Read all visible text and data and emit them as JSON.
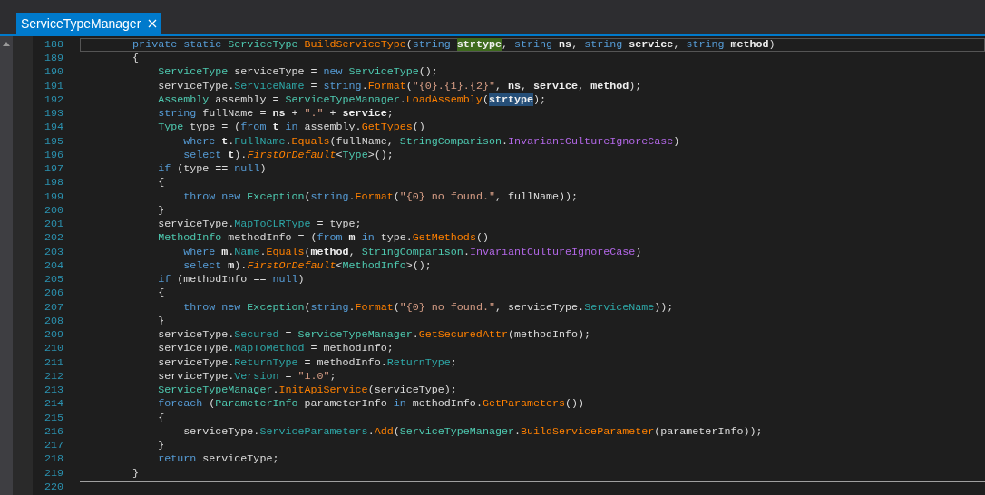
{
  "tabs": [
    {
      "label": "ServiceTypeManager",
      "selected": true
    }
  ],
  "lines": [
    {
      "num": "188",
      "current": true,
      "method_end": false,
      "tokens": [
        {
          "text": "        private static ",
          "kind": "keyword"
        },
        {
          "text": "ServiceType ",
          "kind": "type"
        },
        {
          "text": "BuildServiceType",
          "kind": "method"
        },
        {
          "text": "(",
          "kind": "plain"
        },
        {
          "text": "string ",
          "kind": "keyword"
        },
        {
          "text": "strtype",
          "kind": "highlight-def"
        },
        {
          "text": ", ",
          "kind": "plain"
        },
        {
          "text": "string ",
          "kind": "keyword"
        },
        {
          "text": "ns",
          "kind": "param"
        },
        {
          "text": ", ",
          "kind": "plain"
        },
        {
          "text": "string ",
          "kind": "keyword"
        },
        {
          "text": "service",
          "kind": "param"
        },
        {
          "text": ", ",
          "kind": "plain"
        },
        {
          "text": "string ",
          "kind": "keyword"
        },
        {
          "text": "method",
          "kind": "param"
        },
        {
          "text": ")",
          "kind": "plain"
        }
      ]
    },
    {
      "num": "189",
      "current": false,
      "method_end": false,
      "tokens": [
        {
          "text": "        {",
          "kind": "plain"
        }
      ]
    },
    {
      "num": "190",
      "current": false,
      "method_end": false,
      "tokens": [
        {
          "text": "            ServiceType",
          "kind": "type"
        },
        {
          "text": " serviceType = ",
          "kind": "plain"
        },
        {
          "text": "new ",
          "kind": "keyword"
        },
        {
          "text": "ServiceType",
          "kind": "type"
        },
        {
          "text": "();",
          "kind": "plain"
        }
      ]
    },
    {
      "num": "191",
      "current": false,
      "method_end": false,
      "tokens": [
        {
          "text": "            serviceType.",
          "kind": "plain"
        },
        {
          "text": "ServiceName",
          "kind": "property"
        },
        {
          "text": " = ",
          "kind": "plain"
        },
        {
          "text": "string",
          "kind": "keyword"
        },
        {
          "text": ".",
          "kind": "plain"
        },
        {
          "text": "Format",
          "kind": "method"
        },
        {
          "text": "(",
          "kind": "plain"
        },
        {
          "text": "\"{0}.{1}.{2}\"",
          "kind": "string"
        },
        {
          "text": ", ",
          "kind": "plain"
        },
        {
          "text": "ns",
          "kind": "param"
        },
        {
          "text": ", ",
          "kind": "plain"
        },
        {
          "text": "service",
          "kind": "param"
        },
        {
          "text": ", ",
          "kind": "plain"
        },
        {
          "text": "method",
          "kind": "param"
        },
        {
          "text": ");",
          "kind": "plain"
        }
      ]
    },
    {
      "num": "192",
      "current": false,
      "method_end": false,
      "tokens": [
        {
          "text": "            Assembly",
          "kind": "type"
        },
        {
          "text": " assembly = ",
          "kind": "plain"
        },
        {
          "text": "ServiceTypeManager",
          "kind": "type"
        },
        {
          "text": ".",
          "kind": "plain"
        },
        {
          "text": "LoadAssembly",
          "kind": "method"
        },
        {
          "text": "(",
          "kind": "plain"
        },
        {
          "text": "strtype",
          "kind": "highlight-ref"
        },
        {
          "text": ");",
          "kind": "plain"
        }
      ]
    },
    {
      "num": "193",
      "current": false,
      "method_end": false,
      "tokens": [
        {
          "text": "            string",
          "kind": "keyword"
        },
        {
          "text": " fullName = ",
          "kind": "plain"
        },
        {
          "text": "ns",
          "kind": "param"
        },
        {
          "text": " + ",
          "kind": "plain"
        },
        {
          "text": "\".\"",
          "kind": "string"
        },
        {
          "text": " + ",
          "kind": "plain"
        },
        {
          "text": "service",
          "kind": "param"
        },
        {
          "text": ";",
          "kind": "plain"
        }
      ]
    },
    {
      "num": "194",
      "current": false,
      "method_end": false,
      "tokens": [
        {
          "text": "            Type",
          "kind": "type"
        },
        {
          "text": " type = (",
          "kind": "plain"
        },
        {
          "text": "from ",
          "kind": "keyword"
        },
        {
          "text": "t",
          "kind": "param"
        },
        {
          "text": " in",
          "kind": "keyword"
        },
        {
          "text": " assembly.",
          "kind": "plain"
        },
        {
          "text": "GetTypes",
          "kind": "method"
        },
        {
          "text": "()",
          "kind": "plain"
        }
      ]
    },
    {
      "num": "195",
      "current": false,
      "method_end": false,
      "tokens": [
        {
          "text": "                where ",
          "kind": "keyword"
        },
        {
          "text": "t",
          "kind": "param"
        },
        {
          "text": ".",
          "kind": "plain"
        },
        {
          "text": "FullName",
          "kind": "property"
        },
        {
          "text": ".",
          "kind": "plain"
        },
        {
          "text": "Equals",
          "kind": "method"
        },
        {
          "text": "(fullName, ",
          "kind": "plain"
        },
        {
          "text": "StringComparison",
          "kind": "type"
        },
        {
          "text": ".",
          "kind": "plain"
        },
        {
          "text": "InvariantCultureIgnoreCase",
          "kind": "enum"
        },
        {
          "text": ")",
          "kind": "plain"
        }
      ]
    },
    {
      "num": "196",
      "current": false,
      "method_end": false,
      "tokens": [
        {
          "text": "                select ",
          "kind": "keyword"
        },
        {
          "text": "t",
          "kind": "param"
        },
        {
          "text": ").",
          "kind": "plain"
        },
        {
          "text": "FirstOrDefault",
          "kind": "extension"
        },
        {
          "text": "<",
          "kind": "plain"
        },
        {
          "text": "Type",
          "kind": "type"
        },
        {
          "text": ">();",
          "kind": "plain"
        }
      ]
    },
    {
      "num": "197",
      "current": false,
      "method_end": false,
      "tokens": [
        {
          "text": "            if",
          "kind": "keyword"
        },
        {
          "text": " (type == ",
          "kind": "plain"
        },
        {
          "text": "null",
          "kind": "keyword"
        },
        {
          "text": ")",
          "kind": "plain"
        }
      ]
    },
    {
      "num": "198",
      "current": false,
      "method_end": false,
      "tokens": [
        {
          "text": "            {",
          "kind": "plain"
        }
      ]
    },
    {
      "num": "199",
      "current": false,
      "method_end": false,
      "tokens": [
        {
          "text": "                throw new ",
          "kind": "keyword"
        },
        {
          "text": "Exception",
          "kind": "type"
        },
        {
          "text": "(",
          "kind": "plain"
        },
        {
          "text": "string",
          "kind": "keyword"
        },
        {
          "text": ".",
          "kind": "plain"
        },
        {
          "text": "Format",
          "kind": "method"
        },
        {
          "text": "(",
          "kind": "plain"
        },
        {
          "text": "\"{0} no found.\"",
          "kind": "string"
        },
        {
          "text": ", fullName));",
          "kind": "plain"
        }
      ]
    },
    {
      "num": "200",
      "current": false,
      "method_end": false,
      "tokens": [
        {
          "text": "            }",
          "kind": "plain"
        }
      ]
    },
    {
      "num": "201",
      "current": false,
      "method_end": false,
      "tokens": [
        {
          "text": "            serviceType.",
          "kind": "plain"
        },
        {
          "text": "MapToCLRType",
          "kind": "property"
        },
        {
          "text": " = type;",
          "kind": "plain"
        }
      ]
    },
    {
      "num": "202",
      "current": false,
      "method_end": false,
      "tokens": [
        {
          "text": "            MethodInfo",
          "kind": "type"
        },
        {
          "text": " methodInfo = (",
          "kind": "plain"
        },
        {
          "text": "from ",
          "kind": "keyword"
        },
        {
          "text": "m",
          "kind": "param"
        },
        {
          "text": " in",
          "kind": "keyword"
        },
        {
          "text": " type.",
          "kind": "plain"
        },
        {
          "text": "GetMethods",
          "kind": "method"
        },
        {
          "text": "()",
          "kind": "plain"
        }
      ]
    },
    {
      "num": "203",
      "current": false,
      "method_end": false,
      "tokens": [
        {
          "text": "                where ",
          "kind": "keyword"
        },
        {
          "text": "m",
          "kind": "param"
        },
        {
          "text": ".",
          "kind": "plain"
        },
        {
          "text": "Name",
          "kind": "property"
        },
        {
          "text": ".",
          "kind": "plain"
        },
        {
          "text": "Equals",
          "kind": "method"
        },
        {
          "text": "(",
          "kind": "plain"
        },
        {
          "text": "method",
          "kind": "param"
        },
        {
          "text": ", ",
          "kind": "plain"
        },
        {
          "text": "StringComparison",
          "kind": "type"
        },
        {
          "text": ".",
          "kind": "plain"
        },
        {
          "text": "InvariantCultureIgnoreCase",
          "kind": "enum"
        },
        {
          "text": ")",
          "kind": "plain"
        }
      ]
    },
    {
      "num": "204",
      "current": false,
      "method_end": false,
      "tokens": [
        {
          "text": "                select ",
          "kind": "keyword"
        },
        {
          "text": "m",
          "kind": "param"
        },
        {
          "text": ").",
          "kind": "plain"
        },
        {
          "text": "FirstOrDefault",
          "kind": "extension"
        },
        {
          "text": "<",
          "kind": "plain"
        },
        {
          "text": "MethodInfo",
          "kind": "type"
        },
        {
          "text": ">();",
          "kind": "plain"
        }
      ]
    },
    {
      "num": "205",
      "current": false,
      "method_end": false,
      "tokens": [
        {
          "text": "            if",
          "kind": "keyword"
        },
        {
          "text": " (methodInfo == ",
          "kind": "plain"
        },
        {
          "text": "null",
          "kind": "keyword"
        },
        {
          "text": ")",
          "kind": "plain"
        }
      ]
    },
    {
      "num": "206",
      "current": false,
      "method_end": false,
      "tokens": [
        {
          "text": "            {",
          "kind": "plain"
        }
      ]
    },
    {
      "num": "207",
      "current": false,
      "method_end": false,
      "tokens": [
        {
          "text": "                throw new ",
          "kind": "keyword"
        },
        {
          "text": "Exception",
          "kind": "type"
        },
        {
          "text": "(",
          "kind": "plain"
        },
        {
          "text": "string",
          "kind": "keyword"
        },
        {
          "text": ".",
          "kind": "plain"
        },
        {
          "text": "Format",
          "kind": "method"
        },
        {
          "text": "(",
          "kind": "plain"
        },
        {
          "text": "\"{0} no found.\"",
          "kind": "string"
        },
        {
          "text": ", serviceType.",
          "kind": "plain"
        },
        {
          "text": "ServiceName",
          "kind": "property"
        },
        {
          "text": "));",
          "kind": "plain"
        }
      ]
    },
    {
      "num": "208",
      "current": false,
      "method_end": false,
      "tokens": [
        {
          "text": "            }",
          "kind": "plain"
        }
      ]
    },
    {
      "num": "209",
      "current": false,
      "method_end": false,
      "tokens": [
        {
          "text": "            serviceType.",
          "kind": "plain"
        },
        {
          "text": "Secured",
          "kind": "property"
        },
        {
          "text": " = ",
          "kind": "plain"
        },
        {
          "text": "ServiceTypeManager",
          "kind": "type"
        },
        {
          "text": ".",
          "kind": "plain"
        },
        {
          "text": "GetSecuredAttr",
          "kind": "method"
        },
        {
          "text": "(methodInfo);",
          "kind": "plain"
        }
      ]
    },
    {
      "num": "210",
      "current": false,
      "method_end": false,
      "tokens": [
        {
          "text": "            serviceType.",
          "kind": "plain"
        },
        {
          "text": "MapToMethod",
          "kind": "property"
        },
        {
          "text": " = methodInfo;",
          "kind": "plain"
        }
      ]
    },
    {
      "num": "211",
      "current": false,
      "method_end": false,
      "tokens": [
        {
          "text": "            serviceType.",
          "kind": "plain"
        },
        {
          "text": "ReturnType",
          "kind": "property"
        },
        {
          "text": " = methodInfo.",
          "kind": "plain"
        },
        {
          "text": "ReturnType",
          "kind": "property"
        },
        {
          "text": ";",
          "kind": "plain"
        }
      ]
    },
    {
      "num": "212",
      "current": false,
      "method_end": false,
      "tokens": [
        {
          "text": "            serviceType.",
          "kind": "plain"
        },
        {
          "text": "Version",
          "kind": "property"
        },
        {
          "text": " = ",
          "kind": "plain"
        },
        {
          "text": "\"1.0\"",
          "kind": "string"
        },
        {
          "text": ";",
          "kind": "plain"
        }
      ]
    },
    {
      "num": "213",
      "current": false,
      "method_end": false,
      "tokens": [
        {
          "text": "            ServiceTypeManager",
          "kind": "type"
        },
        {
          "text": ".",
          "kind": "plain"
        },
        {
          "text": "InitApiService",
          "kind": "method"
        },
        {
          "text": "(serviceType);",
          "kind": "plain"
        }
      ]
    },
    {
      "num": "214",
      "current": false,
      "method_end": false,
      "tokens": [
        {
          "text": "            foreach",
          "kind": "keyword"
        },
        {
          "text": " (",
          "kind": "plain"
        },
        {
          "text": "ParameterInfo",
          "kind": "type"
        },
        {
          "text": " parameterInfo ",
          "kind": "plain"
        },
        {
          "text": "in",
          "kind": "keyword"
        },
        {
          "text": " methodInfo.",
          "kind": "plain"
        },
        {
          "text": "GetParameters",
          "kind": "method"
        },
        {
          "text": "())",
          "kind": "plain"
        }
      ]
    },
    {
      "num": "215",
      "current": false,
      "method_end": false,
      "tokens": [
        {
          "text": "            {",
          "kind": "plain"
        }
      ]
    },
    {
      "num": "216",
      "current": false,
      "method_end": false,
      "tokens": [
        {
          "text": "                serviceType.",
          "kind": "plain"
        },
        {
          "text": "ServiceParameters",
          "kind": "property"
        },
        {
          "text": ".",
          "kind": "plain"
        },
        {
          "text": "Add",
          "kind": "method"
        },
        {
          "text": "(",
          "kind": "plain"
        },
        {
          "text": "ServiceTypeManager",
          "kind": "type"
        },
        {
          "text": ".",
          "kind": "plain"
        },
        {
          "text": "BuildServiceParameter",
          "kind": "method"
        },
        {
          "text": "(parameterInfo));",
          "kind": "plain"
        }
      ]
    },
    {
      "num": "217",
      "current": false,
      "method_end": false,
      "tokens": [
        {
          "text": "            }",
          "kind": "plain"
        }
      ]
    },
    {
      "num": "218",
      "current": false,
      "method_end": false,
      "tokens": [
        {
          "text": "            return",
          "kind": "keyword"
        },
        {
          "text": " serviceType;",
          "kind": "plain"
        }
      ]
    },
    {
      "num": "219",
      "current": false,
      "method_end": true,
      "tokens": [
        {
          "text": "        }",
          "kind": "plain"
        }
      ]
    },
    {
      "num": "220",
      "current": false,
      "method_end": false
    }
  ]
}
